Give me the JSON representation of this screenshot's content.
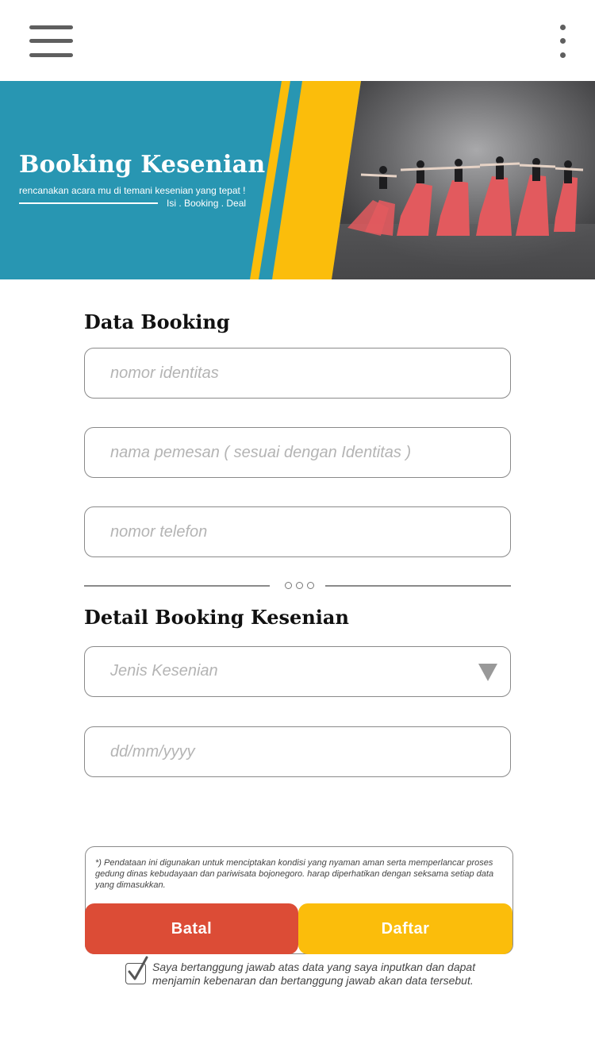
{
  "header": {
    "menu_icon": "hamburger-menu-icon",
    "more_icon": "vertical-dots-more-icon"
  },
  "banner": {
    "title": "Booking Kesenian",
    "subtitle": "rencanakan acara mu di temani kesenian yang tepat !",
    "tagline": "Isi . Booking . Deal",
    "colors": {
      "teal": "#2896b2",
      "yellow": "#fbbd0b"
    }
  },
  "form": {
    "section1_title": "Data Booking",
    "fields": {
      "identity_placeholder": "nomor identitas",
      "name_placeholder": "nama pemesan ( sesuai dengan Identitas )",
      "phone_placeholder": "nomor telefon"
    },
    "section2_title": "Detail Booking Kesenian",
    "art_type_placeholder": "Jenis Kesenian",
    "date_placeholder": "dd/mm/yyyy"
  },
  "note": {
    "text": "*) Pendataan ini digunakan untuk menciptakan kondisi yang nyaman aman serta memperlancar proses gedung dinas kebudayaan dan pariwisata bojonegoro. harap diperhatikan dengan seksama setiap data yang dimasukkan."
  },
  "actions": {
    "cancel_label": "Batal",
    "submit_label": "Daftar",
    "cancel_color": "#dc4c36",
    "submit_color": "#fbbd0b"
  },
  "agreement": {
    "checked": true,
    "text": "Saya bertanggung jawab atas data yang saya inputkan dan dapat menjamin kebenaran dan bertanggung jawab akan data tersebut."
  }
}
